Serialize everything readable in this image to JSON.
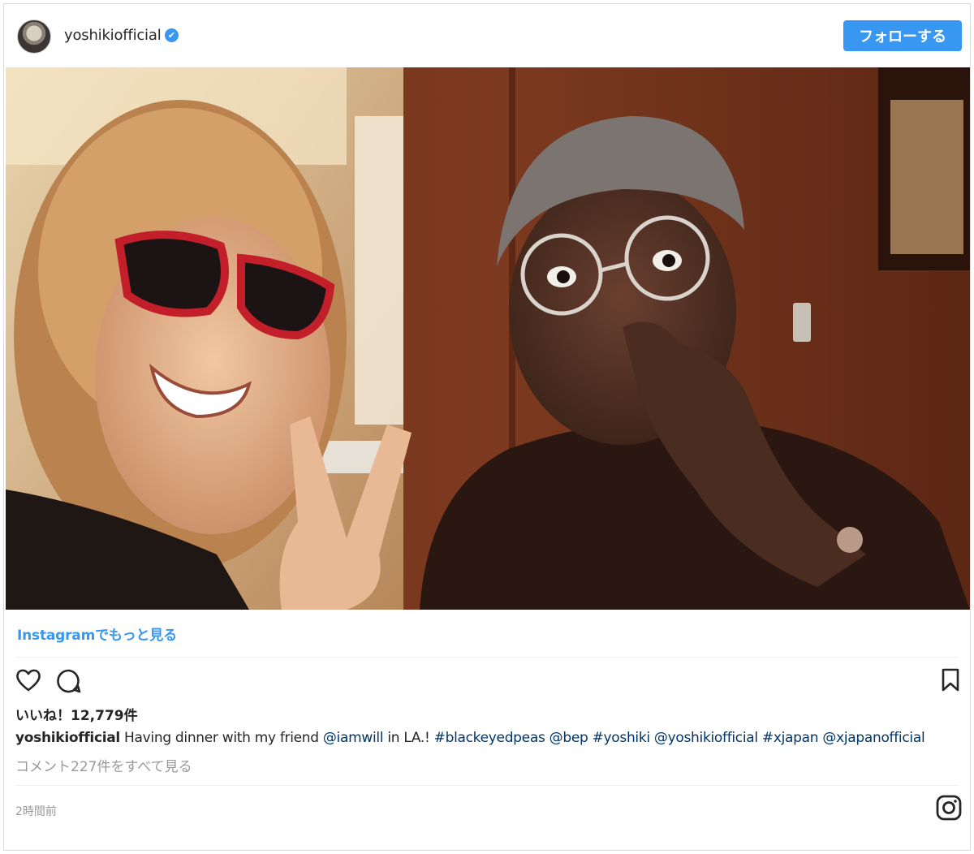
{
  "post": {
    "username": "yoshikiofficial",
    "verified_mark": "✔",
    "follow_label": "フォローする",
    "more_link": "Instagramでもっと見る",
    "likes": "いいね！12,779件",
    "caption": {
      "user": "yoshikiofficial",
      "text_1": " Having dinner with my friend ",
      "mention_1": "@iamwill",
      "text_2": " in LA.! ",
      "tag_1": "#blackeyedpeas",
      "mention_2": "@bep",
      "tag_2": "#yoshiki",
      "mention_3": "@yoshikiofficial",
      "tag_3": "#xjapan",
      "mention_4": "@xjapanofficial"
    },
    "comments_link": "コメント227件をすべて見る",
    "timestamp": "2時間前"
  },
  "icons": {
    "like": "heart-icon",
    "comment": "speech-bubble-icon",
    "save": "bookmark-icon",
    "instagram": "instagram-logo-icon"
  },
  "colors": {
    "accent": "#3897f0",
    "hashtag": "#003569",
    "muted": "#999999"
  }
}
